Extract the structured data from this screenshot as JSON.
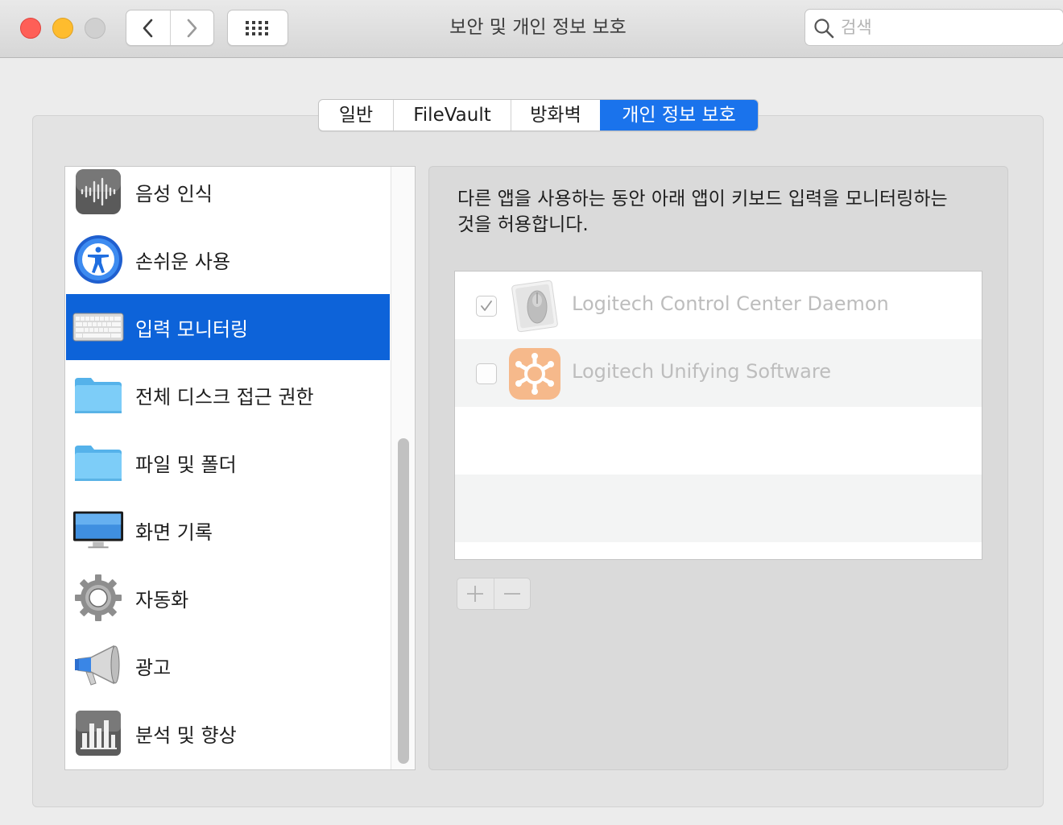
{
  "window": {
    "title": "보안 및 개인 정보 보호",
    "search_placeholder": "검색"
  },
  "tabs": [
    {
      "label": "일반",
      "active": false
    },
    {
      "label": "FileVault",
      "active": false
    },
    {
      "label": "방화벽",
      "active": false
    },
    {
      "label": "개인 정보 보호",
      "active": true
    }
  ],
  "sidebar": {
    "items": [
      {
        "label": "음성 인식",
        "icon": "speech-recognition-icon",
        "selected": false
      },
      {
        "label": "손쉬운 사용",
        "icon": "accessibility-icon",
        "selected": false
      },
      {
        "label": "입력 모니터링",
        "icon": "keyboard-icon",
        "selected": true
      },
      {
        "label": "전체 디스크 접근 권한",
        "icon": "folder-icon",
        "selected": false
      },
      {
        "label": "파일 및 폴더",
        "icon": "folder-icon",
        "selected": false
      },
      {
        "label": "화면 기록",
        "icon": "display-icon",
        "selected": false
      },
      {
        "label": "자동화",
        "icon": "gear-icon",
        "selected": false
      },
      {
        "label": "광고",
        "icon": "megaphone-icon",
        "selected": false
      },
      {
        "label": "분석 및 향상",
        "icon": "analytics-chart-icon",
        "selected": false
      }
    ]
  },
  "panel": {
    "description_line1": "다른 앱을 사용하는 동안 아래 앱이 키보드 입력을 모니터링하는",
    "description_line2": "것을 허용합니다.",
    "apps": [
      {
        "name": "Logitech Control Center Daemon",
        "checked": true,
        "icon": "logitech-mouse-icon"
      },
      {
        "name": "Logitech Unifying Software",
        "checked": false,
        "icon": "logitech-unifying-icon"
      }
    ],
    "add_label": "+",
    "remove_label": "−"
  },
  "colors": {
    "accent": "#1a73ec",
    "selection": "#0d63d9",
    "close": "#fe5f57",
    "minimize": "#febc2e",
    "zoom_disabled": "#d0d0d0"
  }
}
